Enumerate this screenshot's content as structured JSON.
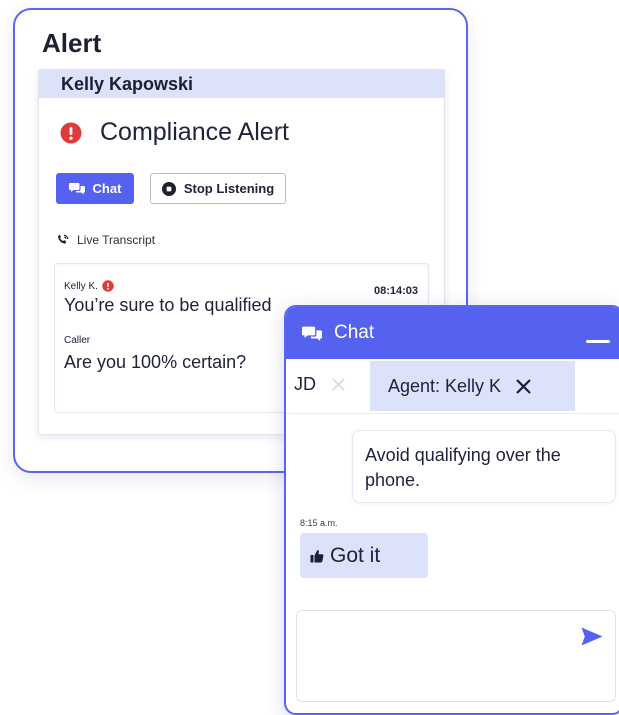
{
  "alert": {
    "title": "Alert",
    "contact_name": "Kelly Kapowski",
    "compliance_text": "Compliance Alert",
    "chat_button": "Chat",
    "stop_button": "Stop Listening",
    "transcript_label": "Live Transcript",
    "transcript": [
      {
        "speaker": "Kelly K.",
        "time": "08:14:03",
        "text": "You’re sure to be qualified",
        "flagged": true
      },
      {
        "speaker": "Caller",
        "text": "Are you 100% certain?"
      }
    ]
  },
  "chat": {
    "title": "Chat",
    "tabs": [
      {
        "label": "JD",
        "active": false
      },
      {
        "label": "Agent: Kelly K",
        "active": true
      }
    ],
    "messages": [
      {
        "direction": "received",
        "text": "Avoid qualifying over the phone."
      },
      {
        "direction": "sent",
        "time": "8:15 a.m.",
        "text": "Got it"
      }
    ],
    "composer_placeholder": ""
  },
  "colors": {
    "accent": "#5562ef",
    "accent_light": "#dde2fb",
    "alert_red": "#e03a3a",
    "border": "#5b66f0"
  },
  "icons": {
    "alert": "exclamation-circle-icon",
    "chat": "chat-bubbles-icon",
    "stop": "stop-circle-icon",
    "phone": "phone-icon",
    "close": "close-icon",
    "thumbs_up": "thumbs-up-icon",
    "send": "send-icon"
  }
}
